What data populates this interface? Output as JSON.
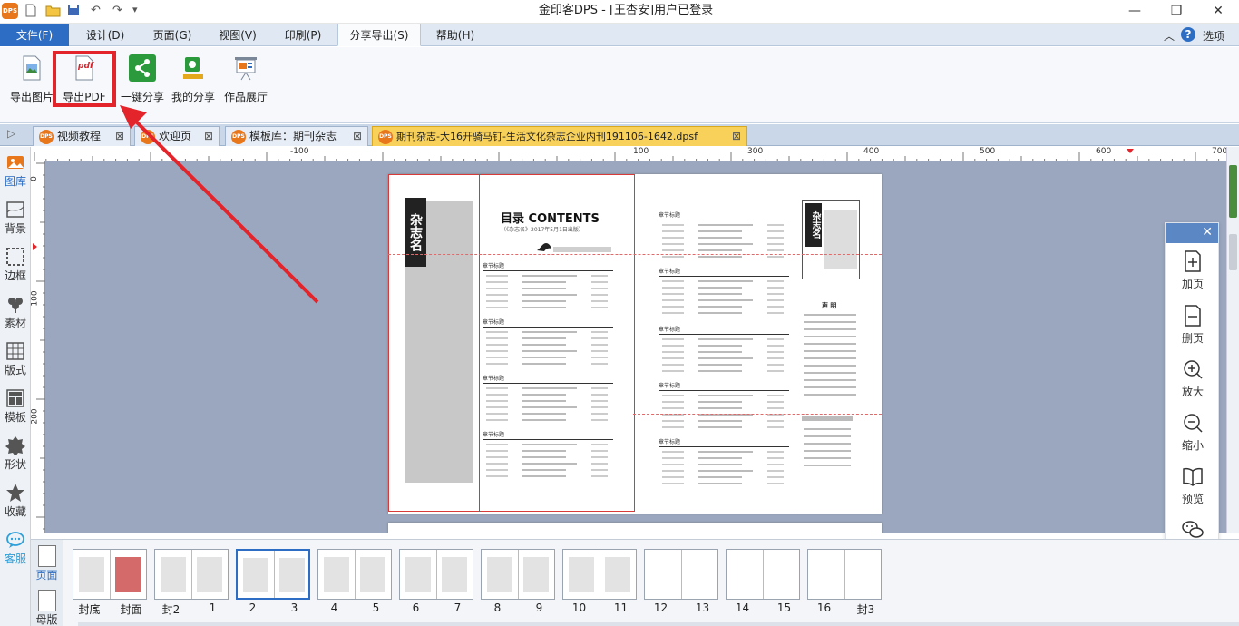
{
  "window": {
    "title": "金印客DPS - [王杏安]用户已登录",
    "min": "—",
    "max": "❐",
    "close": "✕"
  },
  "quick_access": {
    "undo": "↶",
    "redo": "↷",
    "more": "▾"
  },
  "menu": {
    "items": [
      {
        "label": "文件(F)"
      },
      {
        "label": "设计(D)"
      },
      {
        "label": "页面(G)"
      },
      {
        "label": "视图(V)"
      },
      {
        "label": "印刷(P)"
      },
      {
        "label": "分享导出(S)"
      },
      {
        "label": "帮助(H)"
      }
    ],
    "collapse": "︿",
    "help": "?",
    "options": "选项"
  },
  "ribbon": {
    "export_image": "导出图片",
    "export_pdf": "导出PDF",
    "pdf_badge": "pdf",
    "one_click_share": "一键分享",
    "my_share": "我的分享",
    "gallery": "作品展厅",
    "dropdown": "▾"
  },
  "tabs": [
    {
      "label": "视频教程"
    },
    {
      "label": "欢迎页"
    },
    {
      "label": "模板库：期刊杂志"
    },
    {
      "label": "期刊杂志-大16开骑马钉-生活文化杂志企业内刊191106-1642.dpsf"
    }
  ],
  "tab_close": "⊠",
  "dps_badge": "DPS",
  "left_tools": [
    {
      "label": "图库"
    },
    {
      "label": "背景"
    },
    {
      "label": "边框"
    },
    {
      "label": "素材"
    },
    {
      "label": "版式"
    },
    {
      "label": "模板"
    },
    {
      "label": "形状"
    },
    {
      "label": "收藏"
    },
    {
      "label": "客服"
    }
  ],
  "ruler_h": [
    "-100",
    "100",
    "200",
    "300",
    "400",
    "500",
    "600",
    "700"
  ],
  "ruler_v": [
    "0",
    "100",
    "200"
  ],
  "magazine": {
    "toc_title": "目录 CONTENTS",
    "toc_sub": "（《杂志名》2017年5月1日出版）",
    "logo": "杂志名",
    "section": "章节标题",
    "sidebar_title": "声 明"
  },
  "float_panel": {
    "close": "✕",
    "buttons": [
      {
        "label": "加页"
      },
      {
        "label": "删页"
      },
      {
        "label": "放大"
      },
      {
        "label": "缩小"
      },
      {
        "label": "预览"
      },
      {
        "label": "分享"
      }
    ]
  },
  "page_panel": {
    "pages": "页面",
    "master": "母版"
  },
  "thumbnails": [
    {
      "a": "封底",
      "b": "封面",
      "sep": "-"
    },
    {
      "a": "封2",
      "b": "1"
    },
    {
      "a": "2",
      "b": "3"
    },
    {
      "a": "4",
      "b": "5"
    },
    {
      "a": "6",
      "b": "7"
    },
    {
      "a": "8",
      "b": "9"
    },
    {
      "a": "10",
      "b": "11"
    },
    {
      "a": "12",
      "b": "13"
    },
    {
      "a": "14",
      "b": "15"
    },
    {
      "a": "16",
      "b": "封3"
    }
  ],
  "colors": {
    "accent": "#2d6ec4",
    "highlight": "#e3242b",
    "active_tab": "#f8d15b"
  }
}
